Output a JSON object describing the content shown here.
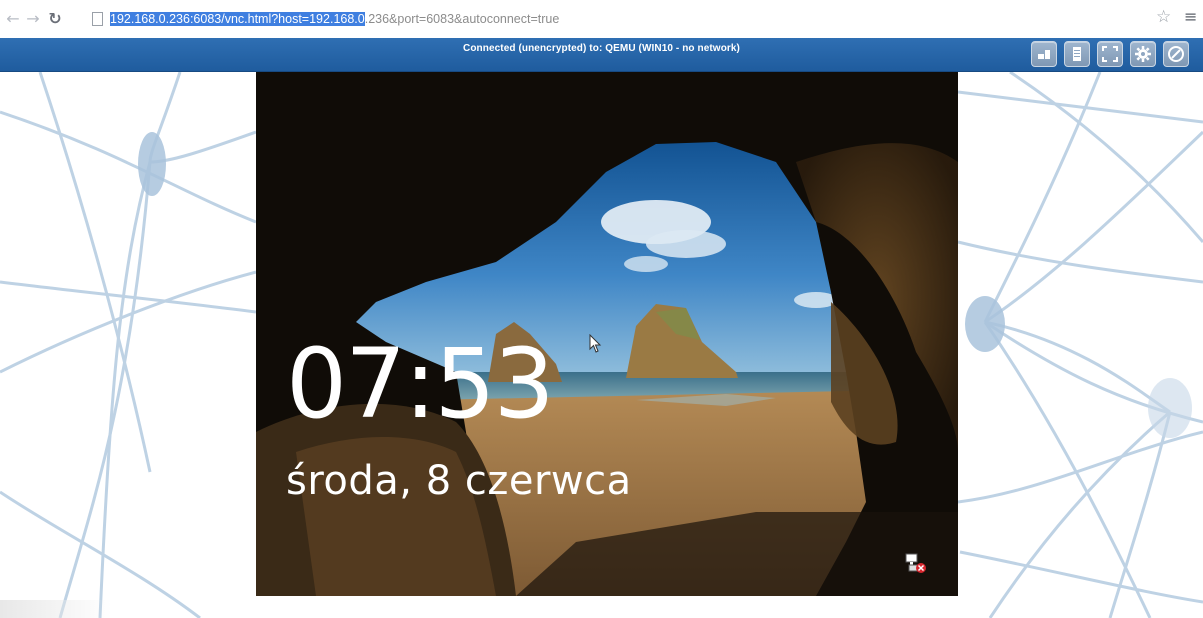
{
  "browser": {
    "back_icon": "arrow-left-icon",
    "forward_icon": "arrow-right-icon",
    "reload_icon": "reload-icon",
    "url_selected": "192.168.0.236:6083/vnc.html?host=192.168.0",
    "url_rest": ".236&port=6083&autoconnect=true",
    "star_icon": "star-icon",
    "menu_icon": "hamburger-menu-icon"
  },
  "vnc": {
    "status": "Connected (unencrypted) to: QEMU (WIN10 - no network)",
    "toolbar": [
      {
        "name": "clipboard-sendkeys-button",
        "icon": "keys-icon"
      },
      {
        "name": "clipboard-button",
        "icon": "clipboard-icon"
      },
      {
        "name": "fullscreen-button",
        "icon": "fullscreen-icon"
      },
      {
        "name": "settings-button",
        "icon": "gear-icon"
      },
      {
        "name": "disconnect-button",
        "icon": "disconnect-icon"
      }
    ],
    "accent_color": "#2a69ad"
  },
  "lockscreen": {
    "time": "07:53",
    "date": "środa, 8 czerwca",
    "network_icon": "network-disconnected-icon"
  }
}
